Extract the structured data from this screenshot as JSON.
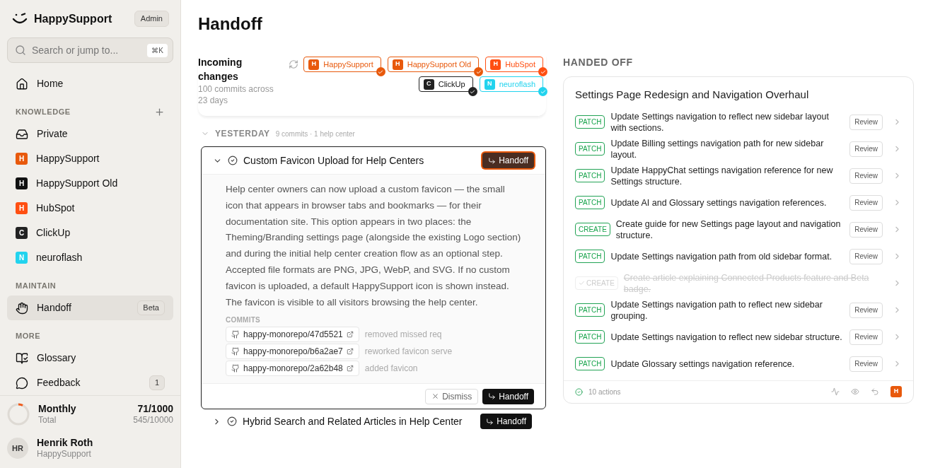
{
  "sidebar": {
    "brand": "HappySupport",
    "role": "Admin",
    "search": {
      "placeholder": "Search or jump to...",
      "shortcut": "⌘K"
    },
    "sections": [
      {
        "items": [
          {
            "kind": "home",
            "label": "Home",
            "selected": false
          }
        ]
      },
      {
        "title": "KNOWLEDGE",
        "add": true,
        "items": [
          {
            "kind": "inbox",
            "label": "Private",
            "selected": false
          },
          {
            "kind": "center",
            "letter": "H",
            "color": "#e8590c",
            "label": "HappySupport",
            "selected": false
          },
          {
            "kind": "center",
            "letter": "H",
            "color": "#111111",
            "label": "HappySupport Old",
            "selected": false
          },
          {
            "kind": "center",
            "letter": "H",
            "color": "#ff4f12",
            "label": "HubSpot",
            "selected": false
          },
          {
            "kind": "center",
            "letter": "C",
            "color": "#222222",
            "label": "ClickUp",
            "selected": false
          },
          {
            "kind": "center",
            "letter": "N",
            "color": "#22d3ee",
            "label": "neuroflash",
            "selected": false
          }
        ]
      },
      {
        "title": "MAINTAIN",
        "items": [
          {
            "kind": "hand",
            "label": "Handoff",
            "badge": "Beta",
            "selected": true
          }
        ]
      },
      {
        "title": "MORE",
        "items": [
          {
            "kind": "book",
            "label": "Glossary",
            "selected": false
          },
          {
            "kind": "chat",
            "label": "Feedback",
            "badge": "1",
            "selected": false
          }
        ]
      }
    ],
    "usage": {
      "label": "Monthly",
      "sublabel": "Total",
      "value": "71/1000",
      "total": "545/10000",
      "level": 0.071
    },
    "user": {
      "initials": "HR",
      "name": "Henrik Roth",
      "org": "HappySupport"
    }
  },
  "page_title": "Handoff",
  "incoming": {
    "title": "Incoming changes",
    "subtitle": "100 commits across 23 days",
    "filters": [
      {
        "letter": "H",
        "label": "HappySupport",
        "color": "#e8590c",
        "checked": true
      },
      {
        "letter": "H",
        "label": "HappySupport Old",
        "color": "#e8590c",
        "checked": true
      },
      {
        "letter": "H",
        "label": "HubSpot",
        "color": "#ff4f12",
        "checked": true
      },
      {
        "letter": "C",
        "label": "ClickUp",
        "color": "#222222",
        "checked": true
      },
      {
        "letter": "N",
        "label": "neuroflash",
        "color": "#22d3ee",
        "checked": true
      }
    ],
    "group": {
      "label": "YESTERDAY",
      "meta": "9 commits · 1 help center",
      "expanded": true
    },
    "changes": [
      {
        "title": "Custom Favicon Upload for Help Centers",
        "expanded": true,
        "action": "Handoff",
        "footer_action": "Handoff",
        "description": "Help center owners can now upload a custom favicon — the small icon that appears in browser tabs and bookmarks — for their documentation site. This option appears in two places: the Theming/Branding settings page (alongside the existing Logo section) and during the initial help center creation flow as an optional step. Accepted file formats are PNG, JPG, WebP, and SVG. If no custom favicon is uploaded, a default HappySupport icon is shown instead. The favicon is visible to all visitors browsing the help center.",
        "commits_label": "COMMITS",
        "commits": [
          {
            "ref": "happy-monorepo/47d5521",
            "message": "removed missed req"
          },
          {
            "ref": "happy-monorepo/b6a2ae7",
            "message": "reworked favicon serve"
          },
          {
            "ref": "happy-monorepo/2a62b48",
            "message": "added favicon"
          }
        ],
        "dismiss": "Dismiss"
      },
      {
        "title": "Hybrid Search and Related Articles in Help Center",
        "expanded": false,
        "action": "Handoff"
      }
    ]
  },
  "handed_off": {
    "title": "HANDED OFF",
    "card": {
      "title": "Settings Page Redesign and Navigation Overhaul",
      "actions": [
        {
          "type": "PATCH",
          "text": "Update Settings navigation to reflect new sidebar layout with sections.",
          "done": false,
          "button": "Review"
        },
        {
          "type": "PATCH",
          "text": "Update Billing settings navigation path for new sidebar layout.",
          "done": false,
          "button": "Review"
        },
        {
          "type": "PATCH",
          "text": "Update HappyChat settings navigation reference for new Settings structure.",
          "done": false,
          "button": "Review"
        },
        {
          "type": "PATCH",
          "text": "Update AI and Glossary settings navigation references.",
          "done": false,
          "button": "Review"
        },
        {
          "type": "CREATE",
          "text": "Create guide for new Settings page layout and navigation structure.",
          "done": false,
          "button": "Review"
        },
        {
          "type": "PATCH",
          "text": "Update Settings navigation path from old sidebar format.",
          "done": false,
          "button": "Review"
        },
        {
          "type": "CREATE",
          "text": "Create article explaining Connected Products feature and Beta badge.",
          "done": true
        },
        {
          "type": "PATCH",
          "text": "Update Settings navigation path to reflect new sidebar grouping.",
          "done": false,
          "button": "Review"
        },
        {
          "type": "PATCH",
          "text": "Update Settings navigation to reflect new sidebar structure.",
          "done": false,
          "button": "Review"
        },
        {
          "type": "PATCH",
          "text": "Update Glossary settings navigation reference.",
          "done": false,
          "button": "Review"
        }
      ],
      "summary": "10 actions",
      "avatar": {
        "letter": "H",
        "color": "#e8590c"
      }
    }
  }
}
